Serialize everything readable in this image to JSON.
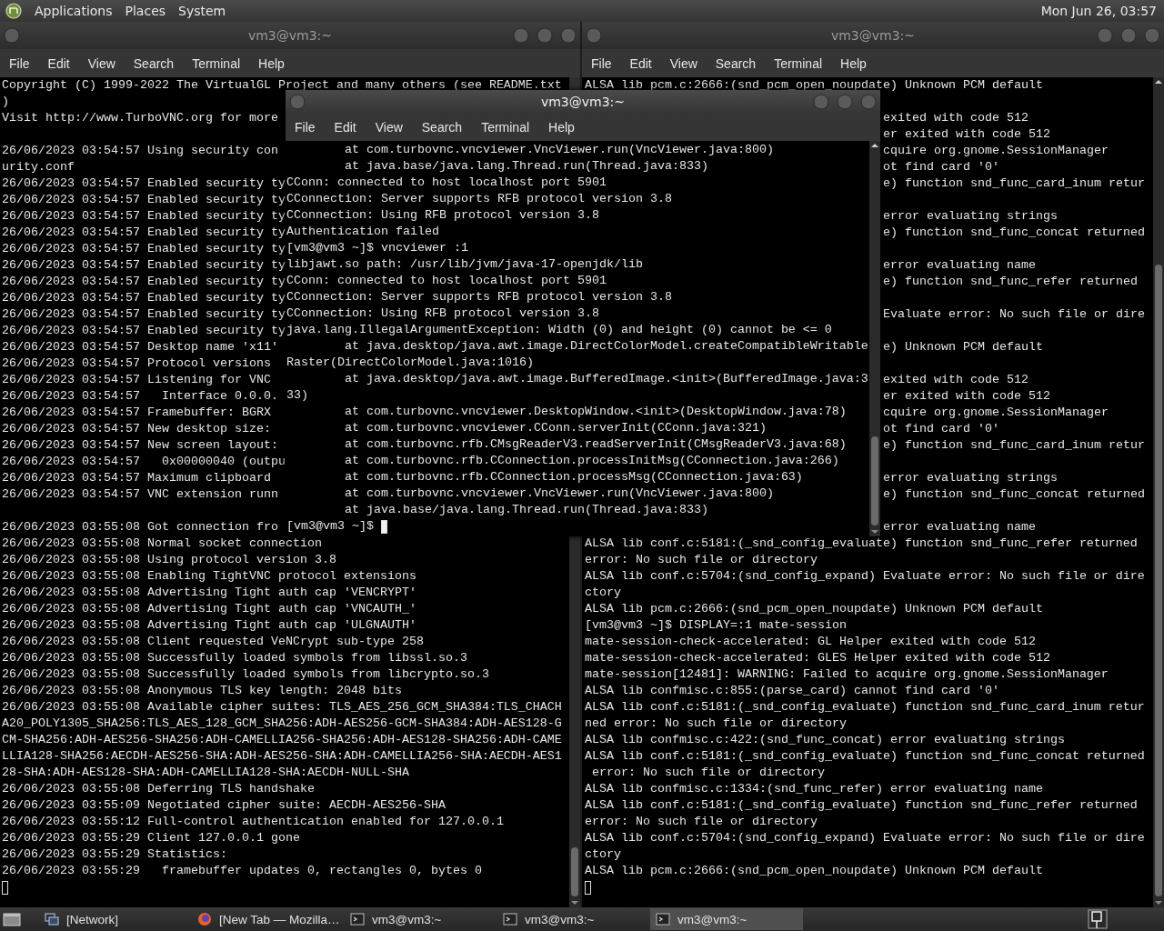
{
  "top_panel": {
    "menus": [
      "Applications",
      "Places",
      "System"
    ],
    "clock": "Mon Jun 26, 03:57"
  },
  "left_terminal": {
    "title": "vm3@vm3:~",
    "active": false,
    "menu": [
      "File",
      "Edit",
      "View",
      "Search",
      "Terminal",
      "Help"
    ],
    "blocks": [
      [
        "Copyright (C) 1999-2022 The VirtualGL Project and many others (see README.txt",
        ")",
        "Visit http://www.TurboVNC.org for more"
      ],
      [
        "26/06/2023 03:54:57 Using security con",
        "urity.conf",
        "26/06/2023 03:54:57 Enabled security ty",
        "26/06/2023 03:54:57 Enabled security ty",
        "26/06/2023 03:54:57 Enabled security ty",
        "26/06/2023 03:54:57 Enabled security ty",
        "26/06/2023 03:54:57 Enabled security ty",
        "26/06/2023 03:54:57 Enabled security ty",
        "26/06/2023 03:54:57 Enabled security ty",
        "26/06/2023 03:54:57 Enabled security ty",
        "26/06/2023 03:54:57 Enabled security ty",
        "26/06/2023 03:54:57 Enabled security ty",
        "26/06/2023 03:54:57 Desktop name 'x11'",
        "26/06/2023 03:54:57 Protocol versions",
        "26/06/2023 03:54:57 Listening for VNC",
        "26/06/2023 03:54:57   Interface 0.0.0.",
        "26/06/2023 03:54:57 Framebuffer: BGRX",
        "26/06/2023 03:54:57 New desktop size:",
        "26/06/2023 03:54:57 New screen layout:",
        "26/06/2023 03:54:57   0x00000040 (outpu",
        "26/06/2023 03:54:57 Maximum clipboard",
        "26/06/2023 03:54:57 VNC extension runn"
      ],
      [
        "26/06/2023 03:55:08 Got connection fro",
        "26/06/2023 03:55:08 Normal socket connection",
        "26/06/2023 03:55:08 Using protocol version 3.8",
        "26/06/2023 03:55:08 Enabling TightVNC protocol extensions",
        "26/06/2023 03:55:08 Advertising Tight auth cap 'VENCRYPT'",
        "26/06/2023 03:55:08 Advertising Tight auth cap 'VNCAUTH_'",
        "26/06/2023 03:55:08 Advertising Tight auth cap 'ULGNAUTH'",
        "26/06/2023 03:55:08 Client requested VeNCrypt sub-type 258",
        "26/06/2023 03:55:08 Successfully loaded symbols from libssl.so.3",
        "26/06/2023 03:55:08 Successfully loaded symbols from libcrypto.so.3",
        "26/06/2023 03:55:08 Anonymous TLS key length: 2048 bits",
        "26/06/2023 03:55:08 Available cipher suites: TLS_AES_256_GCM_SHA384:TLS_CHACH",
        "A20_POLY1305_SHA256:TLS_AES_128_GCM_SHA256:ADH-AES256-GCM-SHA384:ADH-AES128-G",
        "CM-SHA256:ADH-AES256-SHA256:ADH-CAMELLIA256-SHA256:ADH-AES128-SHA256:ADH-CAME",
        "LLIA128-SHA256:AECDH-AES256-SHA:ADH-AES256-SHA:ADH-CAMELLIA256-SHA:AECDH-AES1",
        "28-SHA:ADH-AES128-SHA:ADH-CAMELLIA128-SHA:AECDH-NULL-SHA",
        "26/06/2023 03:55:08 Deferring TLS handshake",
        "26/06/2023 03:55:09 Negotiated cipher suite: AECDH-AES256-SHA",
        "26/06/2023 03:55:12 Full-control authentication enabled for 127.0.0.1",
        "26/06/2023 03:55:29 Client 127.0.0.1 gone",
        "26/06/2023 03:55:29 Statistics:",
        "26/06/2023 03:55:29   framebuffer updates 0, rectangles 0, bytes 0"
      ]
    ]
  },
  "right_terminal": {
    "title": "vm3@vm3:~",
    "active": false,
    "menu": [
      "File",
      "Edit",
      "View",
      "Search",
      "Terminal",
      "Help"
    ],
    "top_lines": [
      "ALSA lib pcm.c:2666:(snd_pcm_open_noupdate) Unknown PCM default"
    ],
    "beside_blocks": [
      [
        "exited with code 512",
        "er exited with code 512",
        "cquire org.gnome.SessionManager",
        "ot find card '0'",
        "e) function snd_func_card_inum retur"
      ],
      [
        "error evaluating strings",
        "e) function snd_func_concat returned"
      ],
      [
        "error evaluating name",
        "e) function snd_func_refer returned"
      ],
      [
        "Evaluate error: No such file or dire"
      ],
      [
        "e) Unknown PCM default"
      ],
      [
        "exited with code 512",
        "er exited with code 512",
        "cquire org.gnome.SessionManager",
        "ot find card '0'",
        "e) function snd_func_card_inum retur"
      ],
      [
        "error evaluating strings",
        "e) function snd_func_concat returned"
      ],
      [
        "error evaluating name"
      ]
    ],
    "lines": [
      "ALSA lib conf.c:5181:(_snd_config_evaluate) function snd_func_refer returned",
      "error: No such file or directory",
      "ALSA lib conf.c:5704:(snd_config_expand) Evaluate error: No such file or dire",
      "ctory",
      "ALSA lib pcm.c:2666:(snd_pcm_open_noupdate) Unknown PCM default",
      "[vm3@vm3 ~]$ DISPLAY=:1 mate-session",
      "mate-session-check-accelerated: GL Helper exited with code 512",
      "mate-session-check-accelerated: GLES Helper exited with code 512",
      "mate-session[12481]: WARNING: Failed to acquire org.gnome.SessionManager",
      "ALSA lib confmisc.c:855:(parse_card) cannot find card '0'",
      "ALSA lib conf.c:5181:(_snd_config_evaluate) function snd_func_card_inum retur",
      "ned error: No such file or directory",
      "ALSA lib confmisc.c:422:(snd_func_concat) error evaluating strings",
      "ALSA lib conf.c:5181:(_snd_config_evaluate) function snd_func_concat returned",
      " error: No such file or directory",
      "ALSA lib confmisc.c:1334:(snd_func_refer) error evaluating name",
      "ALSA lib conf.c:5181:(_snd_config_evaluate) function snd_func_refer returned",
      "error: No such file or directory",
      "ALSA lib conf.c:5704:(snd_config_expand) Evaluate error: No such file or dire",
      "ctory",
      "ALSA lib pcm.c:2666:(snd_pcm_open_noupdate) Unknown PCM default"
    ]
  },
  "front_terminal": {
    "title": "vm3@vm3:~",
    "active": true,
    "menu": [
      "File",
      "Edit",
      "View",
      "Search",
      "Terminal",
      "Help"
    ],
    "lines": [
      "        at com.turbovnc.vncviewer.VncViewer.run(VncViewer.java:800)",
      "        at java.base/java.lang.Thread.run(Thread.java:833)",
      "CConn: connected to host localhost port 5901",
      "CConnection: Server supports RFB protocol version 3.8",
      "CConnection: Using RFB protocol version 3.8",
      "Authentication failed",
      "[vm3@vm3 ~]$ vncviewer :1",
      "libjawt.so path: /usr/lib/jvm/java-17-openjdk/lib",
      "CConn: connected to host localhost port 5901",
      "CConnection: Server supports RFB protocol version 3.8",
      "CConnection: Using RFB protocol version 3.8",
      "java.lang.IllegalArgumentException: Width (0) and height (0) cannot be <= 0",
      "        at java.desktop/java.awt.image.DirectColorModel.createCompatibleWritable",
      "Raster(DirectColorModel.java:1016)",
      "        at java.desktop/java.awt.image.BufferedImage.<init>(BufferedImage.java:3",
      "33)",
      "        at com.turbovnc.vncviewer.DesktopWindow.<init>(DesktopWindow.java:78)",
      "        at com.turbovnc.vncviewer.CConn.serverInit(CConn.java:321)",
      "        at com.turbovnc.rfb.CMsgReaderV3.readServerInit(CMsgReaderV3.java:68)",
      "        at com.turbovnc.rfb.CConnection.processInitMsg(CConnection.java:266)",
      "        at com.turbovnc.rfb.CConnection.processMsg(CConnection.java:63)",
      "        at com.turbovnc.vncviewer.VncViewer.run(VncViewer.java:800)",
      "        at java.base/java.lang.Thread.run(Thread.java:833)"
    ],
    "prompt": "[vm3@vm3 ~]$"
  },
  "taskbar": {
    "items": [
      {
        "kind": "window",
        "label": "[Network]",
        "selected": false
      },
      {
        "kind": "browser",
        "label": "[New Tab — Mozilla…",
        "selected": false
      },
      {
        "kind": "terminal",
        "label": "vm3@vm3:~",
        "selected": false
      },
      {
        "kind": "terminal",
        "label": "vm3@vm3:~",
        "selected": false
      },
      {
        "kind": "terminal",
        "label": "vm3@vm3:~",
        "selected": true
      }
    ]
  }
}
